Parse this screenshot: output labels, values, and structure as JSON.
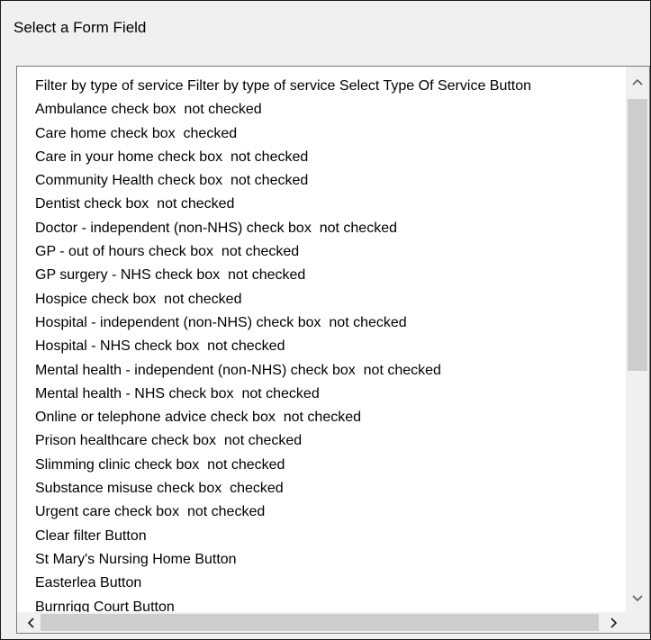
{
  "dialog": {
    "title": "Select a Form Field"
  },
  "list": {
    "items": [
      "Filter by type of service Filter by type of service Select Type Of Service Button",
      "Ambulance check box  not checked",
      "Care home check box  checked",
      "Care in your home check box  not checked",
      "Community Health check box  not checked",
      "Dentist check box  not checked",
      "Doctor - independent (non-NHS) check box  not checked",
      "GP - out of hours check box  not checked",
      "GP surgery - NHS check box  not checked",
      "Hospice check box  not checked",
      "Hospital - independent (non-NHS) check box  not checked",
      "Hospital - NHS check box  not checked",
      "Mental health - independent (non-NHS) check box  not checked",
      "Mental health - NHS check box  not checked",
      "Online or telephone advice check box  not checked",
      "Prison healthcare check box  not checked",
      "Slimming clinic check box  not checked",
      "Substance misuse check box  checked",
      "Urgent care check box  not checked",
      "Clear filter Button",
      "St Mary's Nursing Home Button",
      "Easterlea Button",
      "Burnrigg Court Button"
    ]
  },
  "icons": {
    "scroll_up": "chevron-up-icon",
    "scroll_down": "chevron-down-icon",
    "scroll_left": "chevron-left-icon",
    "scroll_right": "chevron-right-icon"
  },
  "colors": {
    "background": "#f0f0f0",
    "list_background": "#ffffff",
    "scrollbar_thumb": "#cdcdcd",
    "border": "#1a1a1a"
  }
}
